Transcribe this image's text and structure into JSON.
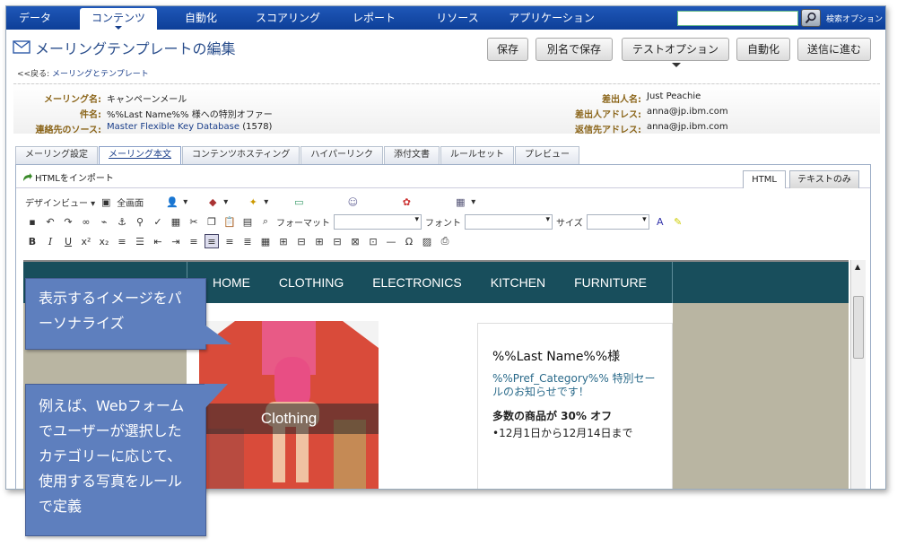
{
  "nav": {
    "tabs": [
      "データ",
      "コンテンツ",
      "自動化",
      "スコアリング",
      "レポート",
      "リソース",
      "アプリケーション"
    ],
    "active": 1,
    "search_options": "検索オプション"
  },
  "title": "メーリングテンプレートの編集",
  "toolbar": {
    "save": "保存",
    "save_as": "別名で保存",
    "test_options": "テストオプション",
    "automate": "自動化",
    "next": "送信に進む"
  },
  "breadcrumb": {
    "back": "<<戻る:",
    "link": "メーリングとテンプレート"
  },
  "info": {
    "mailing_name_label": "メーリング名:",
    "mailing_name": "キャンペーンメール",
    "subject_label": "件名:",
    "subject": "%%Last Name%% 様への特別オファー",
    "source_label": "連絡先のソース:",
    "source": "Master Flexible Key Database",
    "source_count": "(1578)",
    "from_name_label": "差出人名:",
    "from_name": "Just Peachie",
    "from_addr_label": "差出人アドレス:",
    "from_addr": "anna@jp.ibm.com",
    "reply_label": "返信先アドレス:",
    "reply": "anna@jp.ibm.com"
  },
  "subtabs": [
    "メーリング設定",
    "メーリング本文",
    "コンテンツホスティング",
    "ハイパーリンク",
    "添付文書",
    "ルールセット",
    "プレビュー"
  ],
  "subtab_active": 1,
  "editor": {
    "import_label": "HTMLをインポート",
    "view_tabs": [
      "HTML",
      "テキストのみ"
    ],
    "design_view": "デザインビュー",
    "fullscreen": "全画面",
    "format_label": "フォーマット",
    "font_label": "フォント",
    "size_label": "サイズ"
  },
  "email": {
    "nav": [
      "HOME",
      "CLOTHING",
      "ELECTRONICS",
      "KITCHEN",
      "FURNITURE"
    ],
    "hero_caption": "Clothing",
    "promo_name": "%%Last Name%%様",
    "promo_category": "%%Pref_Category%% 特別セールのお知らせです！",
    "promo_sale": "多数の商品が 30% オフ",
    "promo_dates": "•12月1日から12月14日まで"
  },
  "callouts": {
    "personalize": "表示するイメージをパーソナライズ",
    "example": "例えば、Webフォームでユーザーが選択したカテゴリーに応じて、使用する写真をルールで定義"
  },
  "colors": {
    "nav_blue": "#1a4fae",
    "email_nav": "#184e5c",
    "callout": "#5e7fbe",
    "label_gold": "#8a6418"
  }
}
